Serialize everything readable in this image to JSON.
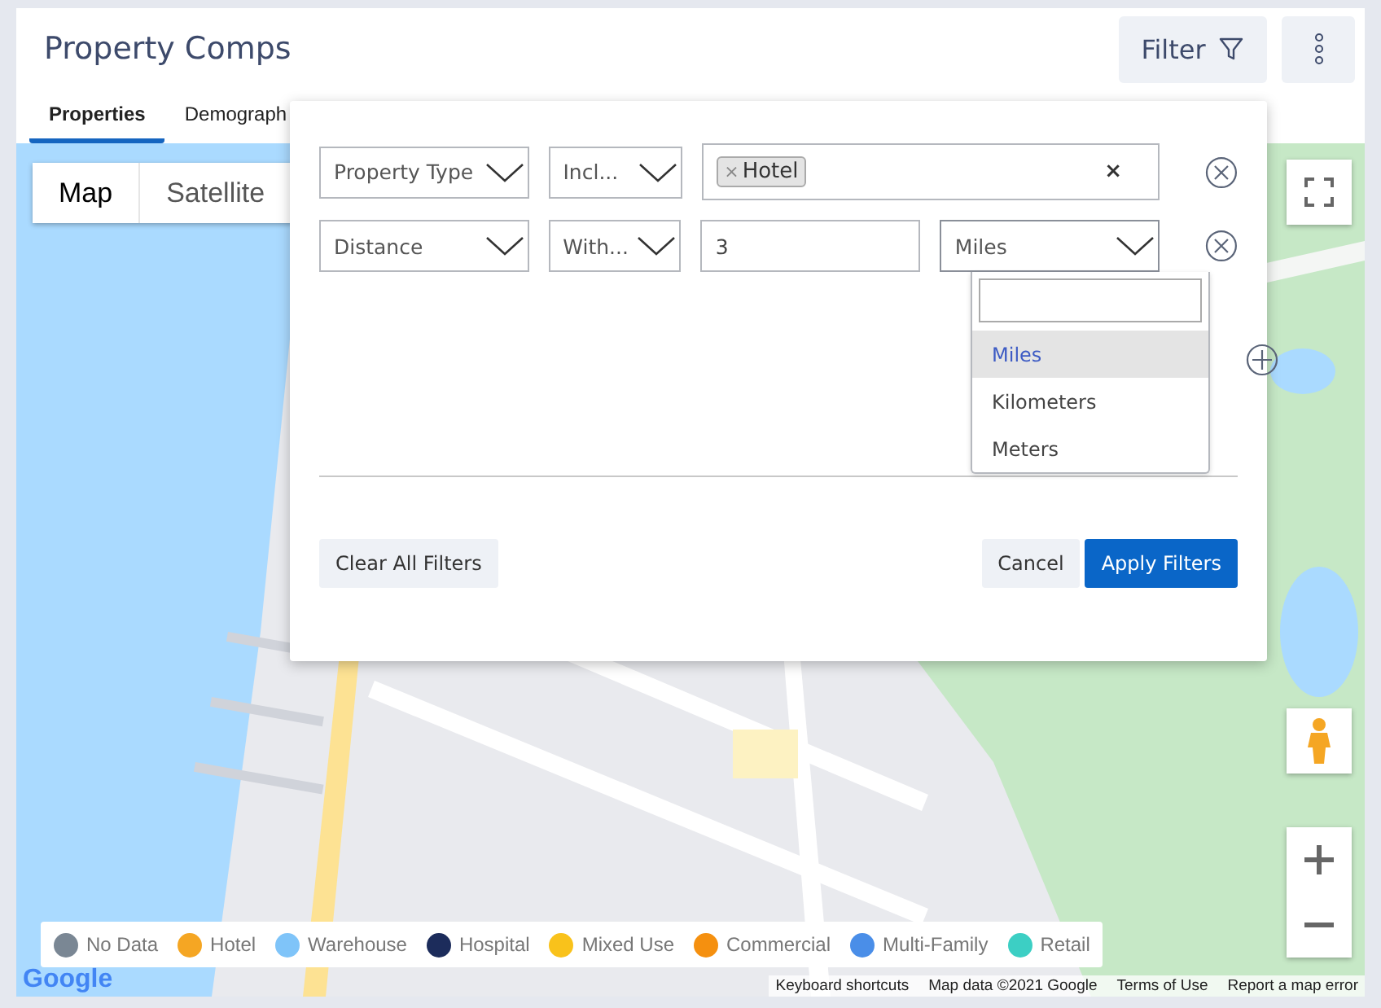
{
  "header": {
    "title": "Property Comps",
    "filter_button": "Filter"
  },
  "tabs": [
    {
      "label": "Properties",
      "selected": true
    },
    {
      "label": "Demograph",
      "selected": false
    }
  ],
  "map": {
    "map_types": [
      {
        "label": "Map",
        "selected": true
      },
      {
        "label": "Satellite",
        "selected": false
      }
    ],
    "legend": [
      {
        "label": "No Data",
        "color": "#7a8794"
      },
      {
        "label": "Hotel",
        "color": "#f5a623"
      },
      {
        "label": "Warehouse",
        "color": "#7fc4f9"
      },
      {
        "label": "Hospital",
        "color": "#1c2c5b"
      },
      {
        "label": "Mixed Use",
        "color": "#f9c21b"
      },
      {
        "label": "Commercial",
        "color": "#f5900f"
      },
      {
        "label": "Multi-Family",
        "color": "#4a8ee8"
      },
      {
        "label": "Retail",
        "color": "#3ccfc4"
      }
    ],
    "logo": "Google",
    "attribution": [
      "Keyboard shortcuts",
      "Map data ©2021 Google",
      "Terms of Use",
      "Report a map error"
    ]
  },
  "filter_panel": {
    "rows": [
      {
        "kind": "tags",
        "field": "Property Type",
        "operator": "Incl...",
        "tags": [
          {
            "label": "Hotel",
            "remove": "×"
          }
        ],
        "clear": "×"
      },
      {
        "kind": "number",
        "field": "Distance",
        "operator": "With...",
        "value": "3",
        "unit": "Miles",
        "unit_open": true
      }
    ],
    "unit_options": [
      {
        "label": "Miles",
        "selected": true
      },
      {
        "label": "Kilometers",
        "selected": false
      },
      {
        "label": "Meters",
        "selected": false
      }
    ],
    "clear_all": "Clear All Filters",
    "cancel": "Cancel",
    "apply": "Apply Filters"
  }
}
